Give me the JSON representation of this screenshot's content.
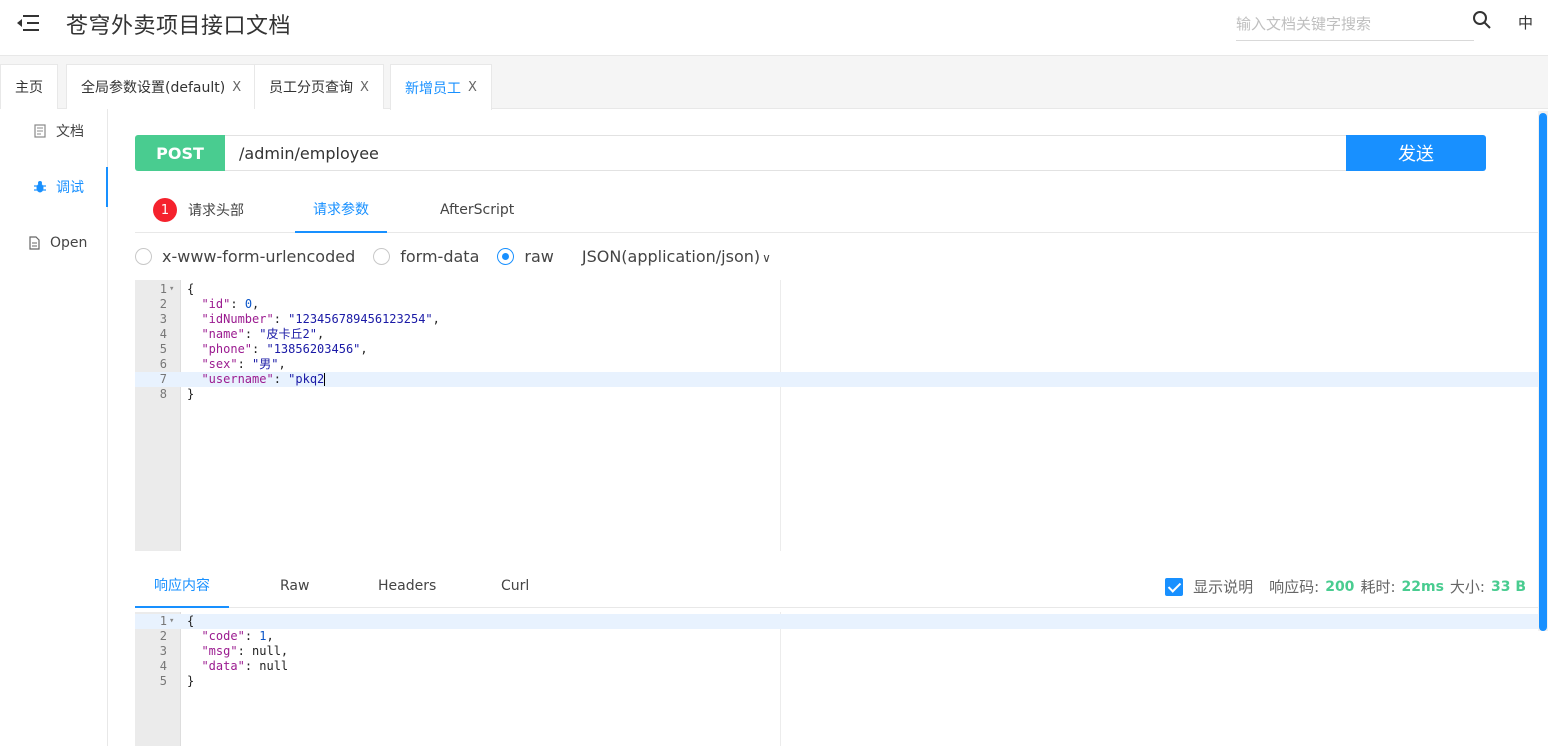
{
  "header": {
    "title": "苍穹外卖项目接口文档",
    "search_placeholder": "输入文档关键字搜索",
    "lang": "中"
  },
  "tabs": [
    {
      "label": "主页",
      "closable": false
    },
    {
      "label": "全局参数设置(default)",
      "closable": true
    },
    {
      "label": "员工分页查询",
      "closable": true
    },
    {
      "label": "新增员工",
      "closable": true,
      "active": true
    }
  ],
  "tab_close_symbol": "X",
  "sidenav": {
    "doc": "文档",
    "debug": "调试",
    "open": "Open"
  },
  "request": {
    "method": "POST",
    "url": "/admin/employee",
    "send_label": "发送",
    "tabs": {
      "headers_count": "1",
      "headers": "请求头部",
      "params": "请求参数",
      "after_script": "AfterScript"
    },
    "body_types": {
      "urlencoded": "x-www-form-urlencoded",
      "form_data": "form-data",
      "raw": "raw",
      "content_type": "JSON(application/json)"
    },
    "body_lines": [
      "{",
      "  \"id\": 0,",
      "  \"idNumber\": \"123456789456123254\",",
      "  \"name\": \"皮卡丘2\",",
      "  \"phone\": \"13856203456\",",
      "  \"sex\": \"男\",",
      "  \"username\": \"pkq2\"",
      "}"
    ]
  },
  "response": {
    "tabs": {
      "content": "响应内容",
      "raw": "Raw",
      "headers": "Headers",
      "curl": "Curl"
    },
    "show_desc": "显示说明",
    "code_label": "响应码:",
    "code": "200",
    "time_label": "耗时:",
    "time": "22ms",
    "size_label": "大小:",
    "size": "33 B",
    "body_lines": [
      "{",
      "  \"code\": 1,",
      "  \"msg\": null,",
      "  \"data\": null",
      "}"
    ]
  },
  "colors": {
    "primary": "#1890ff",
    "post": "#49cc90",
    "badge": "#f5222d"
  }
}
